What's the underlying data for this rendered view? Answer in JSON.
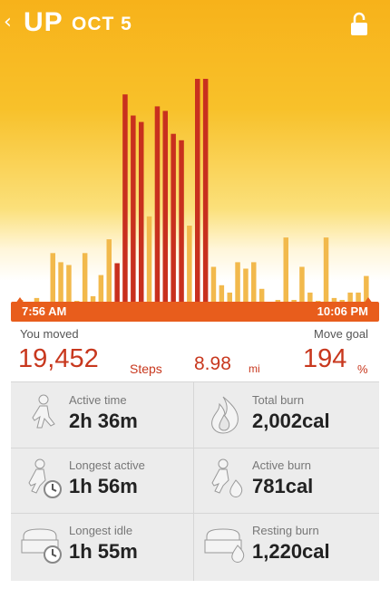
{
  "header": {
    "back_icon": "‹",
    "title": "UP",
    "date": "OCT 5",
    "lock_icon": "lock-open"
  },
  "colors": {
    "bar_light": "#f2b94c",
    "bar_dark": "#c8301e",
    "accent": "#e85d1c",
    "header_yellow": "#f7b21a"
  },
  "timeline": {
    "start": "7:56 AM",
    "end": "10:06 PM"
  },
  "summary": {
    "moved_label": "You moved",
    "steps_value": "19,452",
    "steps_unit": "Steps",
    "miles_value": "8.98",
    "miles_unit": "mi",
    "goal_label": "Move goal",
    "goal_value": "194",
    "goal_unit": "%"
  },
  "stats": [
    {
      "label": "Active time",
      "value": "2h 36m",
      "icon": "runner-icon"
    },
    {
      "label": "Total burn",
      "value": "2,002cal",
      "icon": "flame-icon"
    },
    {
      "label": "Longest active",
      "value": "1h 56m",
      "icon": "runner-timer-icon"
    },
    {
      "label": "Active burn",
      "value": "781cal",
      "icon": "runner-flame-icon"
    },
    {
      "label": "Longest idle",
      "value": "1h 55m",
      "icon": "couch-timer-icon"
    },
    {
      "label": "Resting burn",
      "value": "1,220cal",
      "icon": "couch-flame-icon"
    }
  ],
  "chart_data": {
    "type": "bar",
    "values": [
      4,
      0,
      0,
      7,
      0,
      2,
      0,
      0,
      0,
      0,
      0,
      0,
      0,
      3,
      1,
      0,
      0,
      0,
      52,
      45,
      0,
      40,
      3,
      0,
      55,
      8,
      0,
      31,
      67,
      45,
      44,
      0,
      0,
      0,
      0,
      225,
      214,
      199,
      211,
      0,
      0,
      0,
      0,
      0,
      0,
      0,
      0,
      0,
      0,
      0,
      0,
      0,
      0,
      0,
      0,
      0,
      0,
      0,
      0,
      0,
      0,
      0,
      0,
      0,
      0,
      0,
      0,
      0,
      0,
      0,
      0,
      0,
      0,
      0,
      0,
      0,
      0,
      0,
      0,
      0,
      0,
      0,
      0,
      0,
      0,
      0,
      0,
      0,
      0,
      0,
      0,
      0,
      0,
      0
    ],
    "series": [
      {
        "name": "",
        "bars": [
          {
            "v": 4,
            "h": false
          },
          {
            "v": 2,
            "h": false
          },
          {
            "v": 6,
            "h": false
          },
          {
            "v": 1,
            "h": false
          },
          {
            "v": 55,
            "h": false
          },
          {
            "v": 45,
            "h": false
          },
          {
            "v": 42,
            "h": false
          },
          {
            "v": 3,
            "h": false
          },
          {
            "v": 55,
            "h": false
          },
          {
            "v": 8,
            "h": false
          },
          {
            "v": 31,
            "h": false
          },
          {
            "v": 70,
            "h": false
          },
          {
            "v": 44,
            "h": true
          },
          {
            "v": 228,
            "h": true
          },
          {
            "v": 205,
            "h": true
          },
          {
            "v": 198,
            "h": true
          },
          {
            "v": 95,
            "h": false
          },
          {
            "v": 215,
            "h": true
          },
          {
            "v": 210,
            "h": true
          },
          {
            "v": 185,
            "h": true
          },
          {
            "v": 178,
            "h": true
          },
          {
            "v": 85,
            "h": false
          },
          {
            "v": 245,
            "h": true
          },
          {
            "v": 245,
            "h": true
          },
          {
            "v": 40,
            "h": false
          },
          {
            "v": 20,
            "h": false
          },
          {
            "v": 12,
            "h": false
          },
          {
            "v": 45,
            "h": false
          },
          {
            "v": 38,
            "h": false
          },
          {
            "v": 45,
            "h": false
          },
          {
            "v": 16,
            "h": false
          },
          {
            "v": 2,
            "h": false
          },
          {
            "v": 4,
            "h": false
          },
          {
            "v": 72,
            "h": false
          },
          {
            "v": 4,
            "h": false
          },
          {
            "v": 40,
            "h": false
          },
          {
            "v": 12,
            "h": false
          },
          {
            "v": 3,
            "h": false
          },
          {
            "v": 72,
            "h": false
          },
          {
            "v": 6,
            "h": false
          },
          {
            "v": 4,
            "h": false
          },
          {
            "v": 12,
            "h": false
          },
          {
            "v": 12,
            "h": false
          },
          {
            "v": 30,
            "h": false
          }
        ]
      }
    ],
    "title": "",
    "xlabel": "",
    "ylabel": ""
  }
}
